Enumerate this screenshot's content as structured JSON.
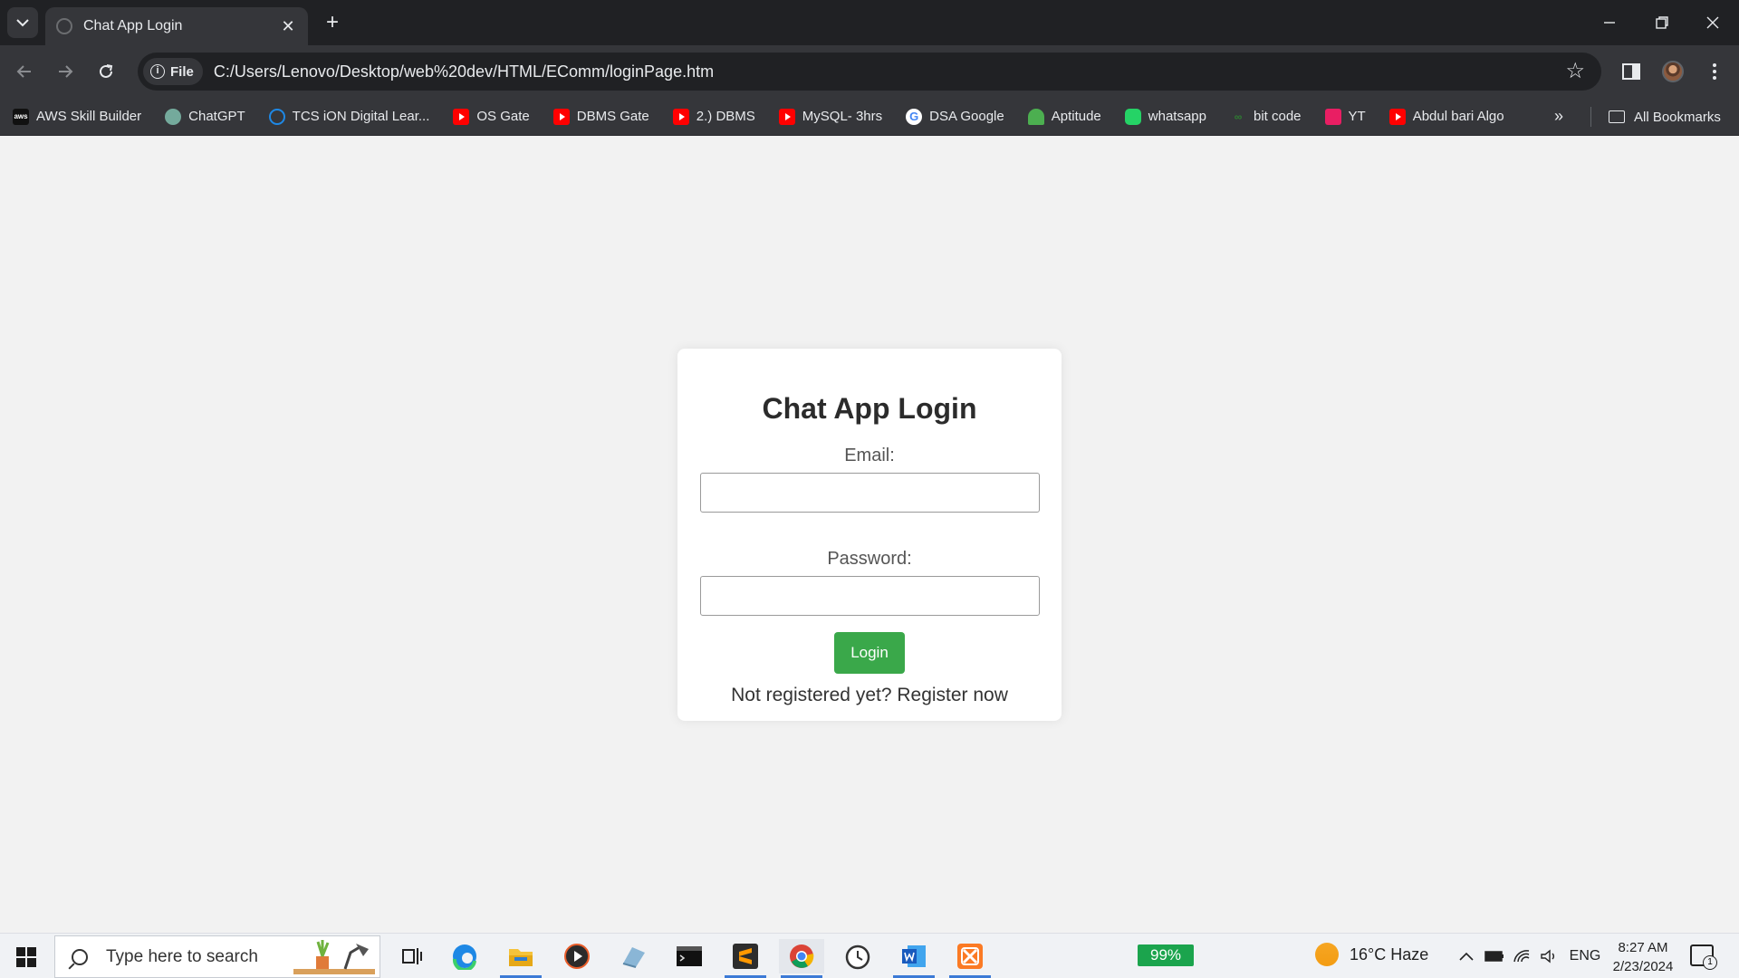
{
  "browser": {
    "tab_title": "Chat App Login",
    "new_tab_symbol": "+",
    "address_chip": "File",
    "url": "C:/Users/Lenovo/Desktop/web%20dev/HTML/EComm/loginPage.htm",
    "bookmarks": [
      {
        "label": "AWS Skill Builder",
        "icon": "aws-icon"
      },
      {
        "label": "ChatGPT",
        "icon": "chatgpt-icon"
      },
      {
        "label": "TCS iON Digital Lear...",
        "icon": "tcs-icon"
      },
      {
        "label": "OS Gate",
        "icon": "youtube-icon"
      },
      {
        "label": "DBMS Gate",
        "icon": "youtube-icon"
      },
      {
        "label": "2.) DBMS",
        "icon": "youtube-icon"
      },
      {
        "label": "MySQL- 3hrs",
        "icon": "youtube-icon"
      },
      {
        "label": "DSA Google",
        "icon": "google-icon"
      },
      {
        "label": "Aptitude",
        "icon": "aptitude-icon"
      },
      {
        "label": "whatsapp",
        "icon": "whatsapp-icon"
      },
      {
        "label": "bit code",
        "icon": "bitcode-icon"
      },
      {
        "label": "YT",
        "icon": "yt-icon"
      },
      {
        "label": "Abdul bari Algo",
        "icon": "youtube-icon"
      }
    ],
    "more_bookmarks": "»",
    "all_bookmarks": "All Bookmarks"
  },
  "page": {
    "heading": "Chat App Login",
    "email_label": "Email:",
    "password_label": "Password:",
    "login_button": "Login",
    "register_text": "Not registered yet? Register now"
  },
  "taskbar": {
    "search_placeholder": "Type here to search",
    "battery_text": "99%",
    "weather": "16°C  Haze",
    "language": "ENG",
    "time": "8:27 AM",
    "date": "2/23/2024",
    "notification_count": "1"
  },
  "colors": {
    "chrome_dark": "#202124",
    "chrome_toolbar": "#35363a",
    "page_background": "#f2f2f2",
    "login_button": "#3aa84a",
    "battery_badge": "#1ba44d"
  }
}
